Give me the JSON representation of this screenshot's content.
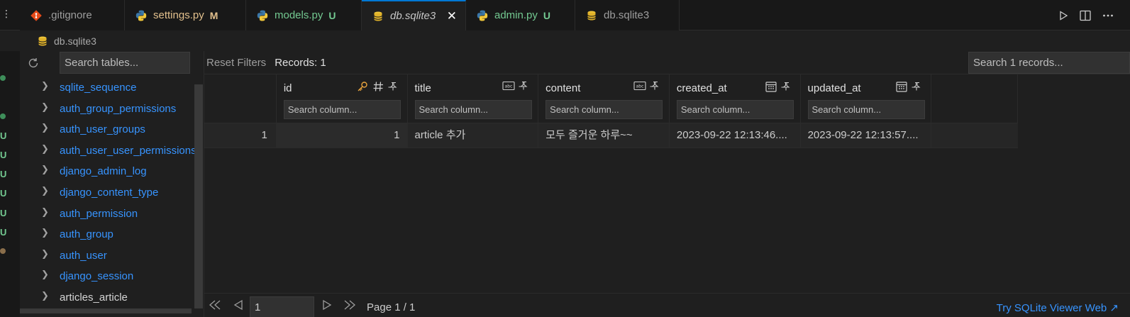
{
  "tabs": [
    {
      "label": ".gitignore",
      "icon": "git-icon",
      "state": "normal",
      "badge": ""
    },
    {
      "label": "settings.py",
      "icon": "python-icon",
      "state": "modified",
      "badge": "M"
    },
    {
      "label": "models.py",
      "icon": "python-icon",
      "state": "untracked",
      "badge": "U"
    },
    {
      "label": "db.sqlite3",
      "icon": "database-icon",
      "state": "active",
      "badge": ""
    },
    {
      "label": "admin.py",
      "icon": "python-icon",
      "state": "untracked",
      "badge": "U"
    },
    {
      "label": "db.sqlite3",
      "icon": "database-icon",
      "state": "normal",
      "badge": ""
    }
  ],
  "tabbar": {
    "close_glyph": "✕",
    "overflow_glyph": "⋮"
  },
  "breadcrumb": {
    "file": "db.sqlite3"
  },
  "gutter": {
    "badges": [
      "U",
      "U",
      "U",
      "U",
      "U",
      "U"
    ]
  },
  "tables_panel": {
    "search_placeholder": "Search tables...",
    "tables": [
      {
        "name": "sqlite_sequence",
        "highlight": true
      },
      {
        "name": "auth_group_permissions",
        "highlight": true
      },
      {
        "name": "auth_user_groups",
        "highlight": true
      },
      {
        "name": "auth_user_user_permissions",
        "highlight": true
      },
      {
        "name": "django_admin_log",
        "highlight": true
      },
      {
        "name": "django_content_type",
        "highlight": true
      },
      {
        "name": "auth_permission",
        "highlight": true
      },
      {
        "name": "auth_group",
        "highlight": true
      },
      {
        "name": "auth_user",
        "highlight": true
      },
      {
        "name": "django_session",
        "highlight": true
      },
      {
        "name": "articles_article",
        "highlight": false
      }
    ]
  },
  "grid": {
    "reset_label": "Reset Filters",
    "records_label": "Records: 1",
    "records_search_placeholder": "Search 1 records...",
    "column_filter_placeholder": "Search column...",
    "columns": [
      {
        "name": "id",
        "type_icon": "hash-icon",
        "key": true
      },
      {
        "name": "title",
        "type_icon": "text-type-icon",
        "key": false
      },
      {
        "name": "content",
        "type_icon": "text-type-icon",
        "key": false
      },
      {
        "name": "created_at",
        "type_icon": "calendar-icon",
        "key": false
      },
      {
        "name": "updated_at",
        "type_icon": "calendar-icon",
        "key": false
      }
    ],
    "rows": [
      {
        "rownum": "1",
        "id": "1",
        "title": "article 추가",
        "content": "모두 즐거운 하루~~",
        "created_at": "2023-09-22 12:13:46....",
        "updated_at": "2023-09-22 12:13:57...."
      }
    ]
  },
  "pager": {
    "page_value": "1",
    "page_text": "Page 1 / 1",
    "try_link": "Try SQLite Viewer Web ↗"
  },
  "colors": {
    "accent": "#0078d4",
    "link": "#3794ff",
    "modified": "#e2c08d",
    "untracked": "#73c991"
  }
}
